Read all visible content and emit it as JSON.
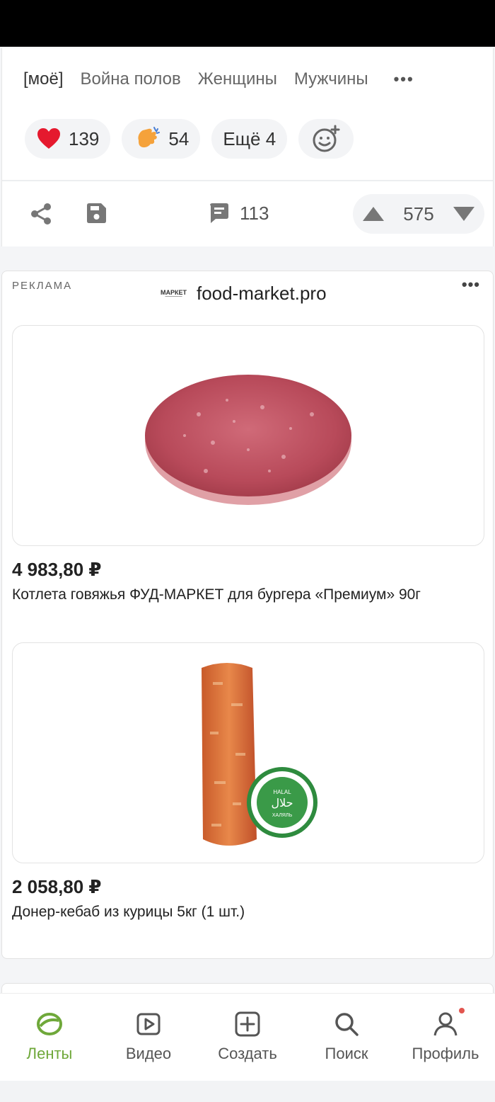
{
  "post": {
    "tags": [
      "[моё]",
      "Война полов",
      "Женщины",
      "Мужчины"
    ],
    "reactions": [
      {
        "icon": "heart-icon",
        "count": "139"
      },
      {
        "icon": "clap-icon",
        "count": "54"
      }
    ],
    "more_reactions": "Ещё 4",
    "comments_count": "113",
    "rating": "575"
  },
  "ad": {
    "label": "РЕКЛАМА",
    "logo_text": "МАРКЕТ",
    "domain": "food-market.pro",
    "products": [
      {
        "price": "4 983,80 ₽",
        "title": "Котлета говяжья ФУД-МАРКЕТ для бургера «Премиум» 90г"
      },
      {
        "price": "2 058,80 ₽",
        "title": "Донер-кебаб из курицы 5кг (1 шт.)"
      }
    ],
    "halal_text": "HALAL",
    "halal_arabic": "حلال",
    "halal_ru": "ХАЛЯЛЬ"
  },
  "tabbar": {
    "items": [
      {
        "label": "Ленты",
        "icon": "feeds-icon",
        "active": true
      },
      {
        "label": "Видео",
        "icon": "video-icon"
      },
      {
        "label": "Создать",
        "icon": "create-icon"
      },
      {
        "label": "Поиск",
        "icon": "search-icon"
      },
      {
        "label": "Профиль",
        "icon": "profile-icon"
      }
    ]
  },
  "colors": {
    "accent": "#6fa83a",
    "heart": "#e5192e",
    "notification_dot": "#e2554f"
  }
}
